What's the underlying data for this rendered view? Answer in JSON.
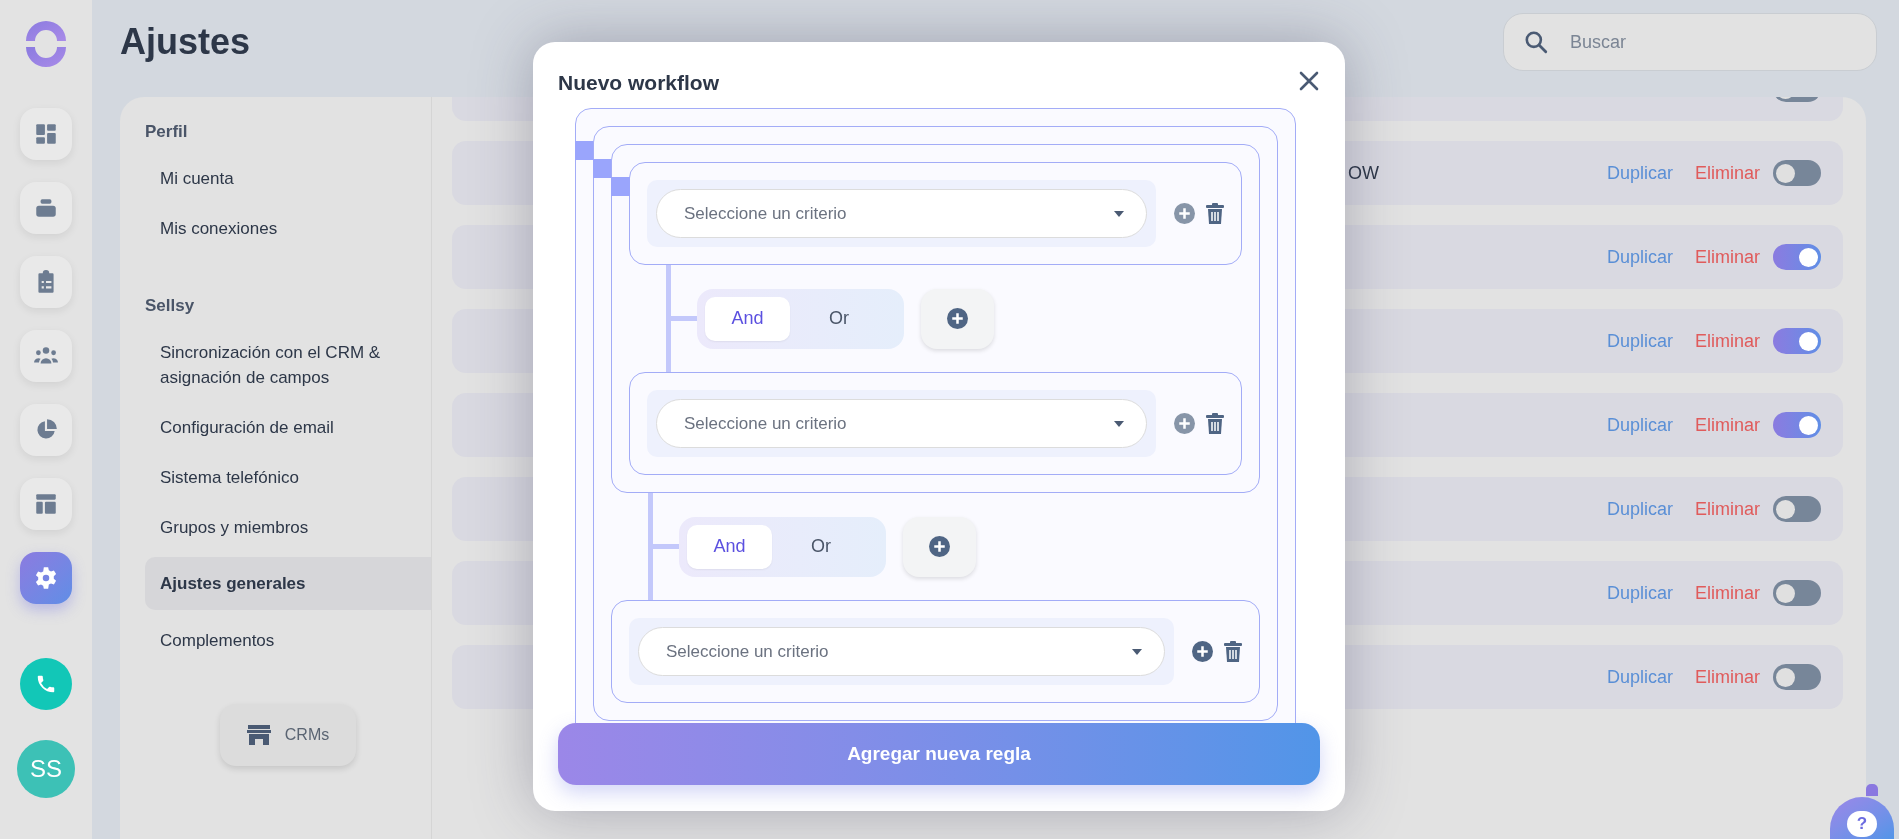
{
  "rail": {
    "items": [
      {
        "kind": "dashboard",
        "selected": false
      },
      {
        "kind": "stack",
        "selected": false
      },
      {
        "kind": "clipboard",
        "selected": false
      },
      {
        "kind": "people",
        "selected": false
      },
      {
        "kind": "pie",
        "selected": false
      },
      {
        "kind": "layout",
        "selected": false
      },
      {
        "kind": "gear",
        "selected": true
      }
    ],
    "avatar": "SS"
  },
  "header": {
    "title": "Ajustes",
    "search": {
      "placeholder": "Buscar"
    }
  },
  "settings_menu": {
    "sections": [
      {
        "title": "Perfil",
        "items": [
          {
            "label": "Mi cuenta",
            "selected": false
          },
          {
            "label": "Mis conexiones",
            "selected": false
          }
        ]
      },
      {
        "title": "Sellsy",
        "items": [
          {
            "label": "Sincronización con el CRM & asignación de campos",
            "selected": false
          },
          {
            "label": "Configuración de email",
            "selected": false
          },
          {
            "label": "Sistema telefónico",
            "selected": false
          },
          {
            "label": "Grupos y miembros",
            "selected": false
          },
          {
            "label": "Ajustes generales",
            "selected": true
          },
          {
            "label": "Complementos",
            "selected": false
          }
        ]
      }
    ],
    "crms_button": "CRMs"
  },
  "cut_row": {
    "on": false
  },
  "rows": [
    {
      "label": "OW",
      "duplicate": "Duplicar",
      "delete": "Eliminar",
      "on": false
    },
    {
      "duplicate": "Duplicar",
      "delete": "Eliminar",
      "on": true
    },
    {
      "duplicate": "Duplicar",
      "delete": "Eliminar",
      "on": true
    },
    {
      "duplicate": "Duplicar",
      "delete": "Eliminar",
      "on": true
    },
    {
      "duplicate": "Duplicar",
      "delete": "Eliminar",
      "on": false
    },
    {
      "duplicate": "Duplicar",
      "delete": "Eliminar",
      "on": false
    },
    {
      "duplicate": "Duplicar",
      "delete": "Eliminar",
      "on": false
    }
  ],
  "modal": {
    "title": "Nuevo workflow",
    "tree": {
      "kind": "group",
      "children": [
        {
          "kind": "group",
          "children": [
            {
              "kind": "group",
              "children": [
                {
                  "kind": "condition",
                  "placeholder": "Seleccione un criterio"
                },
                {
                  "kind": "connector",
                  "options": [
                    {
                      "label": "And",
                      "selected": true
                    },
                    {
                      "label": "Or",
                      "selected": false
                    }
                  ]
                },
                {
                  "kind": "condition",
                  "placeholder": "Seleccione un criterio"
                }
              ]
            },
            {
              "kind": "connector",
              "options": [
                {
                  "label": "And",
                  "selected": true
                },
                {
                  "label": "Or",
                  "selected": false
                }
              ]
            },
            {
              "kind": "condition",
              "placeholder": "Seleccione un criterio"
            }
          ]
        }
      ]
    },
    "add_button": "Agregar nueva regla"
  },
  "help": {
    "label": "?"
  }
}
